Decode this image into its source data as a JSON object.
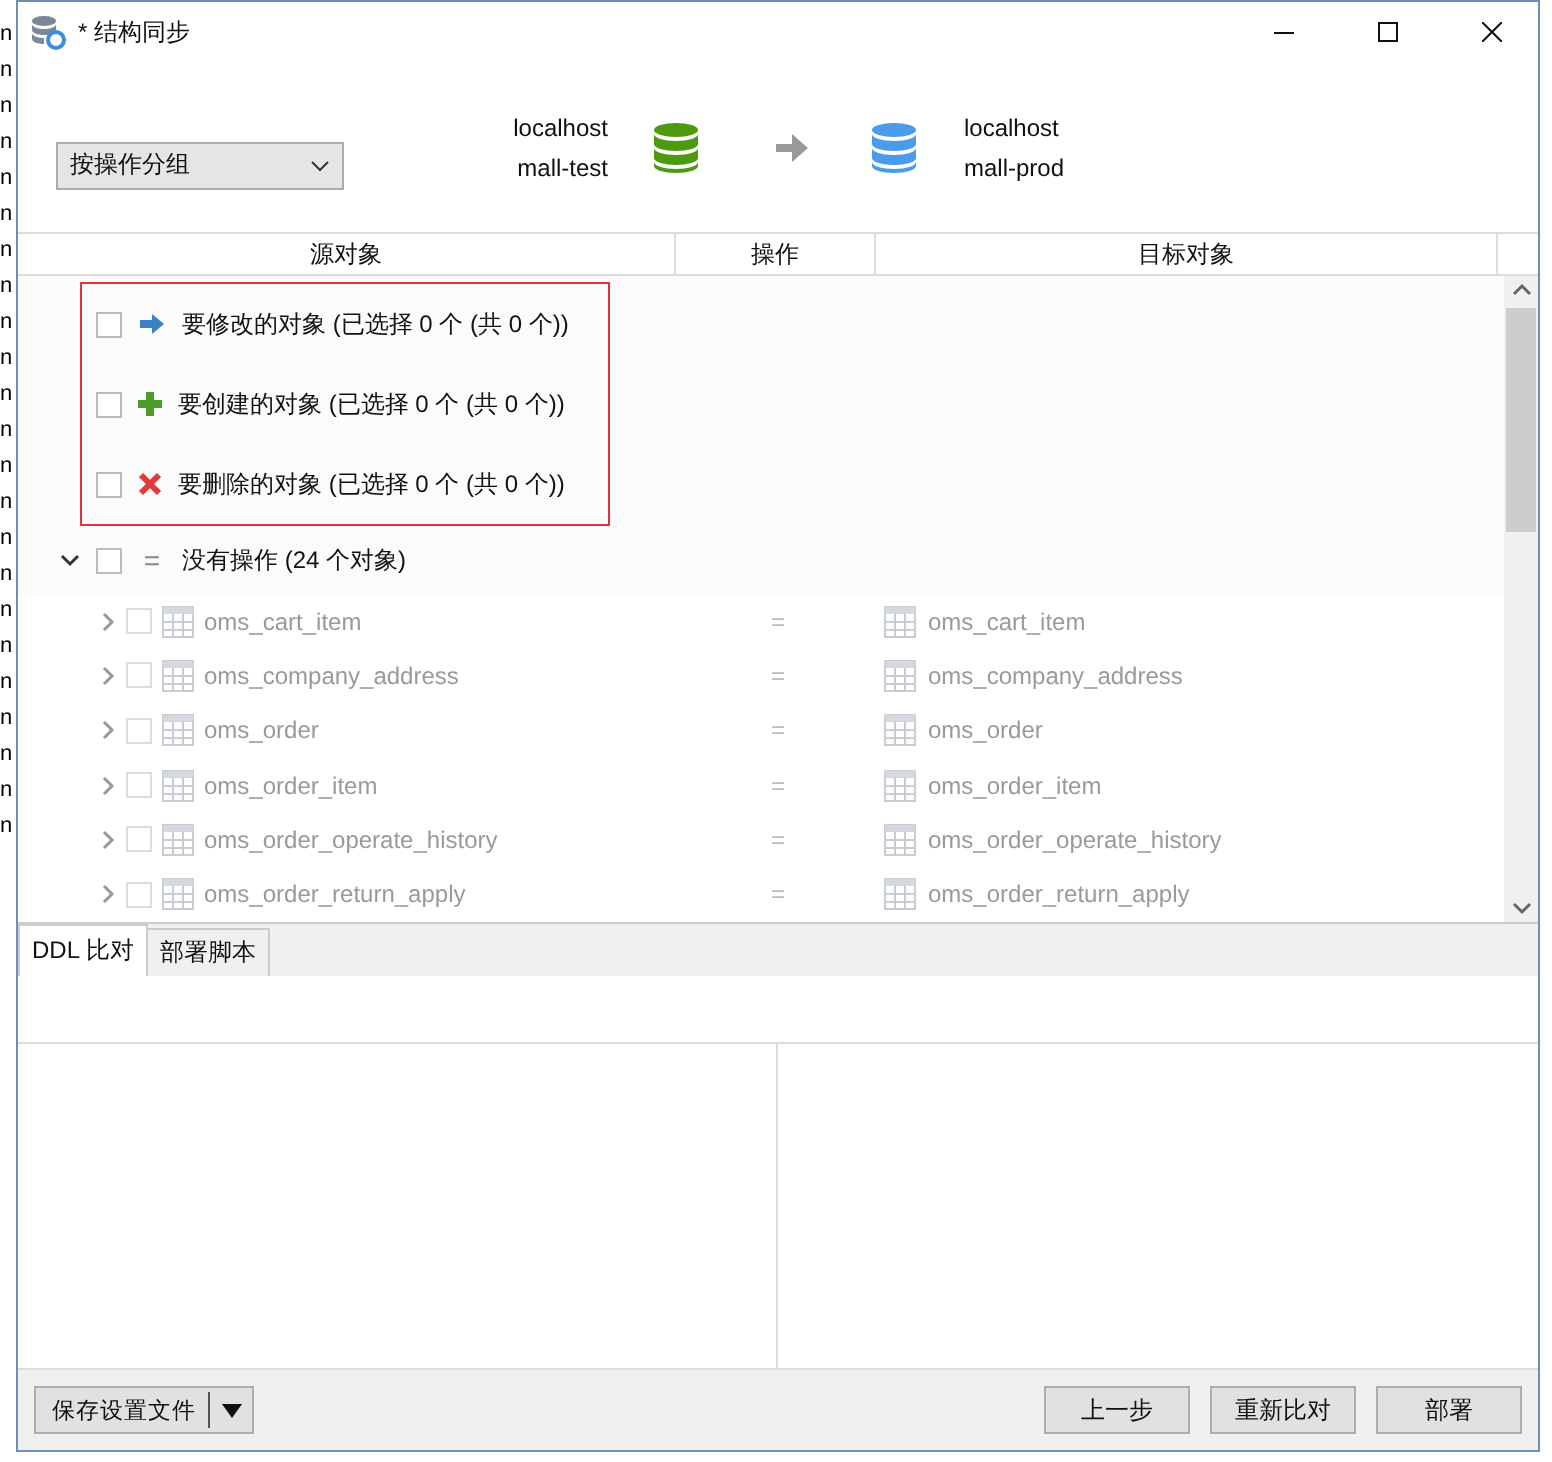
{
  "background_window": {
    "lines": [
      "n",
      "n",
      "n",
      "n",
      "n",
      "n",
      "n",
      "n",
      "n",
      "n",
      "n",
      "n",
      "n",
      "n",
      "n",
      "n",
      "n",
      "n",
      "n",
      "n",
      "n",
      "n",
      "n"
    ]
  },
  "window": {
    "title": "* 结构同步"
  },
  "group_by": {
    "value": "按操作分组"
  },
  "source": {
    "host": "localhost",
    "database": "mall-test"
  },
  "target": {
    "host": "localhost",
    "database": "mall-prod"
  },
  "columns": [
    "源对象",
    "操作",
    "目标对象"
  ],
  "groups": [
    {
      "kind": "modify",
      "label": "要修改的对象 (已选择 0 个 (共 0 个))",
      "checked": false,
      "highlighted": true
    },
    {
      "kind": "create",
      "label": "要创建的对象 (已选择 0 个 (共 0 个))",
      "checked": false,
      "highlighted": true
    },
    {
      "kind": "delete",
      "label": "要删除的对象 (已选择 0 个 (共 0 个))",
      "checked": false,
      "highlighted": true
    },
    {
      "kind": "none",
      "symbol": "=",
      "label": "没有操作 (24 个对象)",
      "checked": false,
      "highlighted": false,
      "expanded": true,
      "children": [
        {
          "source": "oms_cart_item",
          "operation": "=",
          "target": "oms_cart_item",
          "checked": false,
          "disabled": true
        },
        {
          "source": "oms_company_address",
          "operation": "=",
          "target": "oms_company_address",
          "checked": false,
          "disabled": true
        },
        {
          "source": "oms_order",
          "operation": "=",
          "target": "oms_order",
          "checked": false,
          "disabled": true
        },
        {
          "source": "oms_order_item",
          "operation": "=",
          "target": "oms_order_item",
          "checked": false,
          "disabled": true
        },
        {
          "source": "oms_order_operate_history",
          "operation": "=",
          "target": "oms_order_operate_history",
          "checked": false,
          "disabled": true
        },
        {
          "source": "oms_order_return_apply",
          "operation": "=",
          "target": "oms_order_return_apply",
          "checked": false,
          "disabled": true
        }
      ]
    }
  ],
  "tabs": [
    {
      "label": "DDL 比对",
      "selected": true
    },
    {
      "label": "部署脚本",
      "selected": false
    }
  ],
  "footer": {
    "save_button": "保存设置文件",
    "buttons": [
      "上一步",
      "重新比对",
      "部署"
    ]
  }
}
